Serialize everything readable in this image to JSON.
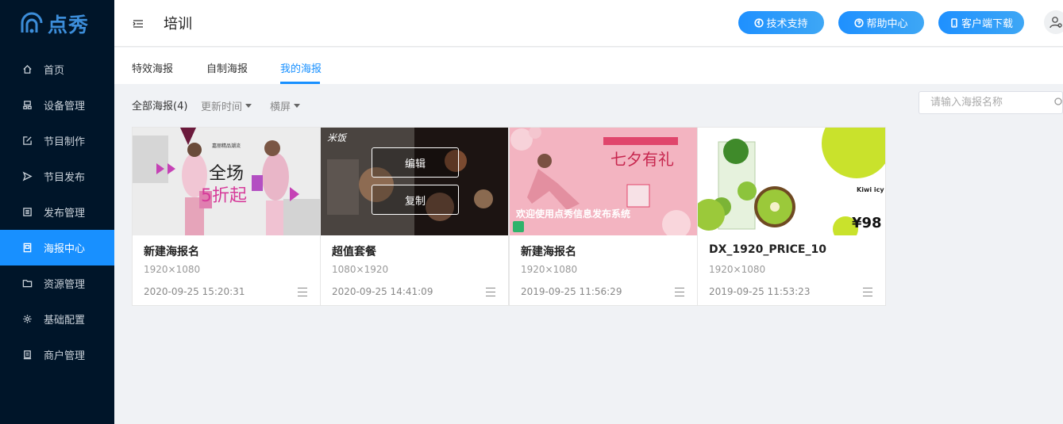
{
  "brand": {
    "logo_text": "点秀"
  },
  "sidebar": {
    "items": [
      {
        "label": "首页",
        "icon": "home-icon"
      },
      {
        "label": "设备管理",
        "icon": "device-icon"
      },
      {
        "label": "节目制作",
        "icon": "edit-icon"
      },
      {
        "label": "节目发布",
        "icon": "send-icon"
      },
      {
        "label": "发布管理",
        "icon": "list-icon"
      },
      {
        "label": "海报中心",
        "icon": "poster-icon",
        "active": true
      },
      {
        "label": "资源管理",
        "icon": "folder-icon"
      },
      {
        "label": "基础配置",
        "icon": "gear-icon"
      },
      {
        "label": "商户管理",
        "icon": "merchant-icon"
      }
    ]
  },
  "header": {
    "title": "培训",
    "support_label": "技术支持",
    "help_label": "帮助中心",
    "download_label": "客户端下载"
  },
  "tabs": [
    {
      "label": "特效海报"
    },
    {
      "label": "自制海报"
    },
    {
      "label": "我的海报",
      "active": true
    }
  ],
  "filter": {
    "all_label": "全部海报(4)",
    "sort_label": "更新时间",
    "orientation_label": "横屏"
  },
  "search": {
    "placeholder": "请输入海报名称"
  },
  "cards": [
    {
      "title": "新建海报名",
      "size": "1920×1080",
      "date": "2020-09-25 15:20:31",
      "thumb": {
        "line1": "全场",
        "line2": "5折起",
        "brand": "嘉丽精品潮流"
      }
    },
    {
      "title": "超值套餐",
      "size": "1080×1920",
      "date": "2020-09-25 14:41:09",
      "thumb": {
        "logo": "米饭",
        "edit_label": "编辑",
        "copy_label": "复制"
      }
    },
    {
      "title": "新建海报名",
      "size": "1920×1080",
      "date": "2019-09-25 11:56:29",
      "thumb": {
        "heading": "七夕有礼",
        "banner": "欢迎使用点秀信息发布系统"
      }
    },
    {
      "title": "DX_1920_PRICE_10",
      "size": "1920×1080",
      "date": "2019-09-25 11:53:23",
      "thumb": {
        "brand": "Kiwi icy",
        "price": "¥98"
      }
    }
  ],
  "colors": {
    "sidebar_bg": "#001529",
    "accent": "#1890ff",
    "page_bg": "#f0f2f5"
  }
}
